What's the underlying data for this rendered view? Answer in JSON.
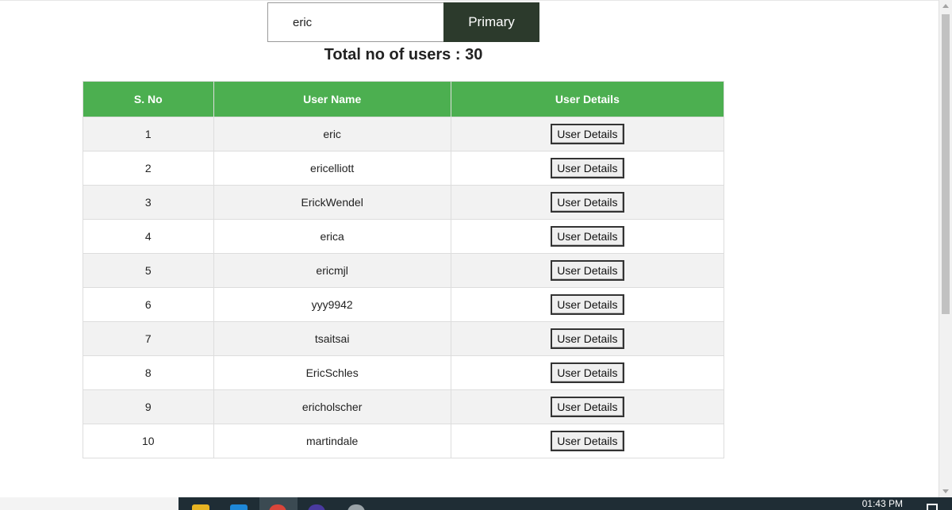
{
  "search": {
    "value": "eric",
    "button_label": "Primary"
  },
  "summary": {
    "total_text": "Total no of users : 30"
  },
  "table": {
    "headers": [
      "S. No",
      "User Name",
      "User Details"
    ],
    "rows": [
      {
        "sno": "1",
        "name": "eric",
        "button": "User Details"
      },
      {
        "sno": "2",
        "name": "ericelliott",
        "button": "User Details"
      },
      {
        "sno": "3",
        "name": "ErickWendel",
        "button": "User Details"
      },
      {
        "sno": "4",
        "name": "erica",
        "button": "User Details"
      },
      {
        "sno": "5",
        "name": "ericmjl",
        "button": "User Details"
      },
      {
        "sno": "6",
        "name": "yyy9942",
        "button": "User Details"
      },
      {
        "sno": "7",
        "name": "tsaitsai",
        "button": "User Details"
      },
      {
        "sno": "8",
        "name": "EricSchles",
        "button": "User Details"
      },
      {
        "sno": "9",
        "name": "ericholscher",
        "button": "User Details"
      },
      {
        "sno": "10",
        "name": "martindale",
        "button": "User Details"
      }
    ]
  },
  "taskbar": {
    "clock": "01:43 PM",
    "icons": [
      "file-explorer-icon",
      "vscode-icon",
      "chrome-icon",
      "app-icon",
      "app-icon"
    ]
  },
  "colors": {
    "header_bg": "#4caf50",
    "primary_button_bg": "#2c3a2c",
    "row_stripe": "#f2f2f2",
    "taskbar_bg": "#1f2d35"
  }
}
